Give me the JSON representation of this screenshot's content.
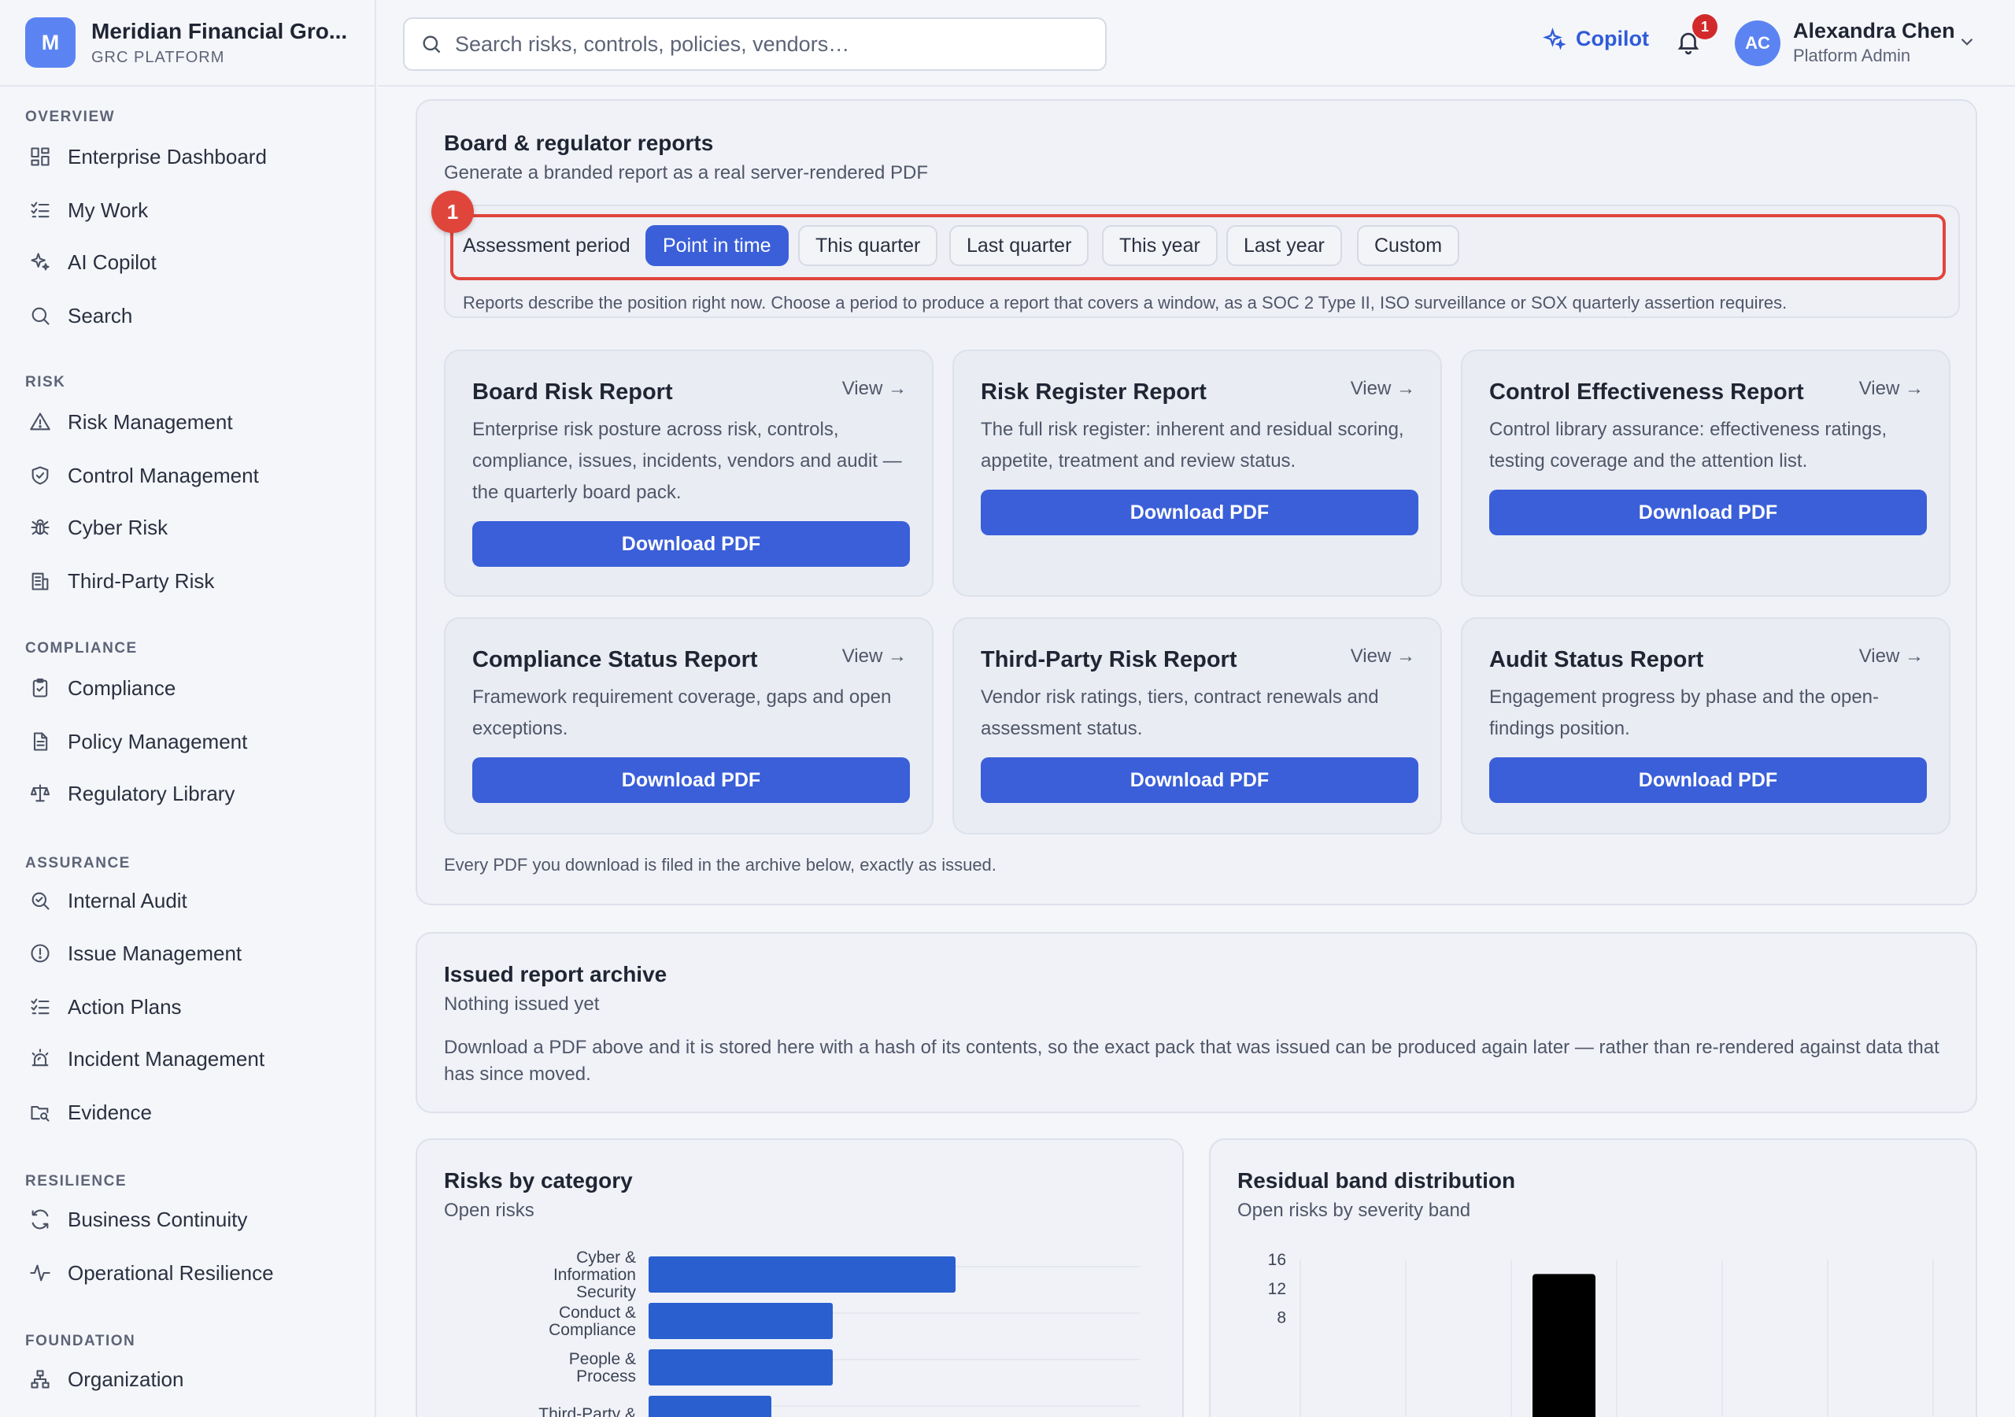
{
  "brand": {
    "logo_letter": "M",
    "name": "Meridian Financial Gro...",
    "subtitle": "GRC PLATFORM"
  },
  "sidebar": {
    "sections": [
      {
        "title": "OVERVIEW",
        "items": [
          {
            "label": "Enterprise Dashboard",
            "icon": "dashboard-icon"
          },
          {
            "label": "My Work",
            "icon": "checklist-icon"
          },
          {
            "label": "AI Copilot",
            "icon": "sparkles-icon"
          },
          {
            "label": "Search",
            "icon": "search-icon"
          }
        ]
      },
      {
        "title": "RISK",
        "items": [
          {
            "label": "Risk Management",
            "icon": "warning-triangle-icon"
          },
          {
            "label": "Control Management",
            "icon": "shield-icon"
          },
          {
            "label": "Cyber Risk",
            "icon": "bug-icon"
          },
          {
            "label": "Third-Party Risk",
            "icon": "building-icon"
          }
        ]
      },
      {
        "title": "COMPLIANCE",
        "items": [
          {
            "label": "Compliance",
            "icon": "clipboard-check-icon"
          },
          {
            "label": "Policy Management",
            "icon": "document-icon"
          },
          {
            "label": "Regulatory Library",
            "icon": "scale-icon"
          }
        ]
      },
      {
        "title": "ASSURANCE",
        "items": [
          {
            "label": "Internal Audit",
            "icon": "magnifier-check-icon"
          },
          {
            "label": "Issue Management",
            "icon": "alert-circle-icon"
          },
          {
            "label": "Action Plans",
            "icon": "checklist-icon"
          },
          {
            "label": "Incident Management",
            "icon": "siren-icon"
          },
          {
            "label": "Evidence",
            "icon": "folder-search-icon"
          }
        ]
      },
      {
        "title": "RESILIENCE",
        "items": [
          {
            "label": "Business Continuity",
            "icon": "refresh-icon"
          },
          {
            "label": "Operational Resilience",
            "icon": "pulse-icon"
          }
        ]
      },
      {
        "title": "FOUNDATION",
        "items": [
          {
            "label": "Organization",
            "icon": "org-chart-icon"
          }
        ]
      }
    ]
  },
  "topbar": {
    "search_placeholder": "Search risks, controls, policies, vendors…",
    "copilot_label": "Copilot",
    "notification_count": "1",
    "user": {
      "initials": "AC",
      "name": "Alexandra Chen",
      "role": "Platform Admin"
    }
  },
  "reports": {
    "title": "Board & regulator reports",
    "subtitle": "Generate a branded report as a real server-rendered PDF",
    "marker": "1",
    "period_label": "Assessment period",
    "periods": [
      "Point in time",
      "This quarter",
      "Last quarter",
      "This year",
      "Last year",
      "Custom"
    ],
    "selected_period": "Point in time",
    "period_note": "Reports describe the position right now. Choose a period to produce a report that covers a window, as a SOC 2 Type II, ISO surveillance or SOX quarterly assertion requires.",
    "view_label": "View →",
    "download_label": "Download PDF",
    "cards": [
      {
        "title": "Board Risk Report",
        "description": "Enterprise risk posture across risk, controls, compliance, issues, incidents, vendors and audit — the quarterly board pack."
      },
      {
        "title": "Risk Register Report",
        "description": "The full risk register: inherent and residual scoring, appetite, treatment and review status."
      },
      {
        "title": "Control Effectiveness Report",
        "description": "Control library assurance: effectiveness ratings, testing coverage and the attention list."
      },
      {
        "title": "Compliance Status Report",
        "description": "Framework requirement coverage, gaps and open exceptions."
      },
      {
        "title": "Third-Party Risk Report",
        "description": "Vendor risk ratings, tiers, contract renewals and assessment status."
      },
      {
        "title": "Audit Status Report",
        "description": "Engagement progress by phase and the open-findings position."
      }
    ],
    "footnote": "Every PDF you download is filed in the archive below, exactly as issued."
  },
  "archive": {
    "title": "Issued report archive",
    "subtitle": "Nothing issued yet",
    "description": "Download a PDF above and it is stored here with a hash of its contents, so the exact pack that was issued can be produced again later — rather than re-rendered against data that has since moved."
  },
  "chart_data": [
    {
      "type": "bar",
      "orientation": "horizontal",
      "title": "Risks by category",
      "subtitle": "Open risks",
      "categories": [
        [
          "Cyber &",
          "Information",
          "Security"
        ],
        [
          "Conduct &",
          "Compliance"
        ],
        [
          "People &",
          "Process"
        ],
        [
          "Third-Party &"
        ]
      ],
      "values": [
        5,
        3,
        3,
        2
      ],
      "xlim": [
        0,
        8
      ],
      "color": "#2a5fcf",
      "grid": true
    },
    {
      "type": "bar",
      "title": "Residual band distribution",
      "subtitle": "Open risks by severity band",
      "values": [
        0,
        0,
        14,
        0,
        0,
        0
      ],
      "ylim": [
        0,
        16
      ],
      "yticks": [
        "16",
        "12",
        "8"
      ],
      "color": "#000000",
      "grid": true
    }
  ]
}
